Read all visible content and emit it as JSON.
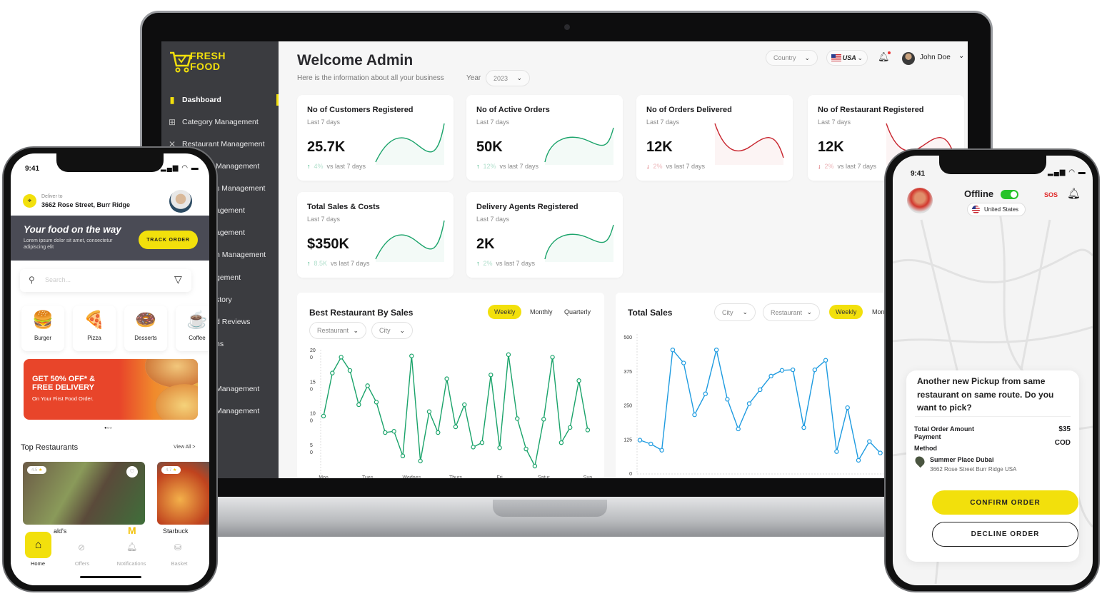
{
  "dashboard": {
    "brand": "FRESH FOOD",
    "title": "Welcome Admin",
    "subtitle": "Here is the information about all your business",
    "year_label": "Year",
    "year_value": "2023",
    "country_placeholder": "Country",
    "language": "USA",
    "user_name": "John Doe",
    "sidebar": {
      "items": [
        {
          "label": "Dashboard",
          "active": true
        },
        {
          "label": "Category Management"
        },
        {
          "label": "Restaurant Management"
        }
      ],
      "partial_items": [
        "Management",
        "s Management",
        "agement",
        "agement",
        "n Management",
        "gement",
        "story",
        "d Reviews",
        "ns",
        "Management",
        "Management"
      ]
    },
    "cards": [
      {
        "title": "No of Customers Registered",
        "period": "Last 7 days",
        "value": "25.7K",
        "trend": "up",
        "change": "4%",
        "compare": "vs last 7 days"
      },
      {
        "title": "No of Active Orders",
        "period": "Last 7 days",
        "value": "50K",
        "trend": "up",
        "change": "12%",
        "compare": "vs last 7 days"
      },
      {
        "title": "No of Orders Delivered",
        "period": "Last 7 days",
        "value": "12K",
        "trend": "down",
        "change": "2%",
        "compare": "vs last 7 days"
      },
      {
        "title": "No of Restaurant Registered",
        "period": "Last 7 days",
        "value": "12K",
        "trend": "down",
        "change": "2%",
        "compare": "vs last 7 days"
      },
      {
        "title": "Total Sales & Costs",
        "period": "Last 7 days",
        "value": "$350K",
        "trend": "up",
        "change": "8.5K",
        "compare": "vs last 7 days"
      },
      {
        "title": "Delivery Agents Registered",
        "period": "Last 7 days",
        "value": "2K",
        "trend": "up",
        "change": "2%",
        "compare": "vs last 7 days"
      }
    ],
    "best_restaurant_panel": {
      "title": "Best Restaurant By Sales",
      "tabs": [
        "Weekly",
        "Monthly",
        "Quarterly"
      ],
      "active_tab": "Weekly",
      "filters": [
        "Restaurant",
        "City"
      ]
    },
    "total_sales_panel": {
      "title": "Total Sales",
      "filters": [
        "City",
        "Restaurant"
      ],
      "tabs": [
        "Weekly",
        "Monthly"
      ],
      "active_tab": "Weekly"
    }
  },
  "chart_data": [
    {
      "type": "line",
      "title": "Best Restaurant By Sales",
      "color": "#1aa36a",
      "ylim": [
        0,
        200
      ],
      "yticks": [
        "200",
        "150",
        "100",
        "50"
      ],
      "xticks": [
        "Mon",
        "Tues",
        "Wednes",
        "Thurs",
        "Fri",
        "Satur",
        "Sun"
      ],
      "values": [
        102,
        170,
        195,
        174,
        120,
        150,
        124,
        76,
        78,
        39,
        197,
        31,
        109,
        76,
        161,
        85,
        120,
        53,
        60,
        167,
        52,
        199,
        98,
        50,
        23,
        97,
        195,
        60,
        84,
        158,
        80
      ]
    },
    {
      "type": "line",
      "title": "Total Sales",
      "color": "#1e9be0",
      "ylim": [
        0,
        500
      ],
      "yticks": [
        "500",
        "375",
        "250",
        "125",
        "0"
      ],
      "values": [
        124,
        110,
        87,
        455,
        407,
        217,
        294,
        455,
        274,
        165,
        258,
        309,
        359,
        380,
        382,
        170,
        382,
        417,
        82,
        243,
        50,
        119,
        77
      ]
    }
  ],
  "customer_app": {
    "time": "9:41",
    "deliver_to_label": "Deliver to",
    "address": "3662 Rose Street, Burr Ridge",
    "banner_title": "Your food on the way",
    "banner_text": "Lorem ipsum dolor sit amet, consectetur adipiscing elit",
    "track_button": "TRACK ORDER",
    "search_placeholder": "Search...",
    "categories": [
      {
        "label": "Burger",
        "icon": "🍔"
      },
      {
        "label": "Pizza",
        "icon": "🍕"
      },
      {
        "label": "Desserts",
        "icon": "🍩"
      },
      {
        "label": "Coffee",
        "icon": "☕"
      }
    ],
    "promo_line1": "GET 50% OFF* &",
    "promo_line2": "FREE DELIVERY",
    "promo_line3": "On Your First Food Order.",
    "section_title": "Top Restaurants",
    "view_all": "View All >",
    "restaurants": [
      {
        "name": "ald's",
        "rating": "4.5"
      },
      {
        "name": "Starbuck",
        "rating": "4.7"
      }
    ],
    "nav": [
      "Home",
      "Offers",
      "Notifications",
      "Basket"
    ],
    "accent": "#f2e00c"
  },
  "driver_app": {
    "time": "9:41",
    "status": "Offline",
    "sos": "SOS",
    "country": "United States",
    "question": "Another new Pickup from same restaurant on same route. Do you want to pick?",
    "total_label": "Total Order Amount",
    "total_value": "$35",
    "payment_label_1": "Payment",
    "payment_label_2": "Method",
    "payment_value": "COD",
    "restaurant_name": "Summer Place Dubai",
    "restaurant_address": "3662 Rose Street Burr Ridge USA",
    "confirm": "CONFIRM ORDER",
    "decline": "DECLINE ORDER"
  }
}
